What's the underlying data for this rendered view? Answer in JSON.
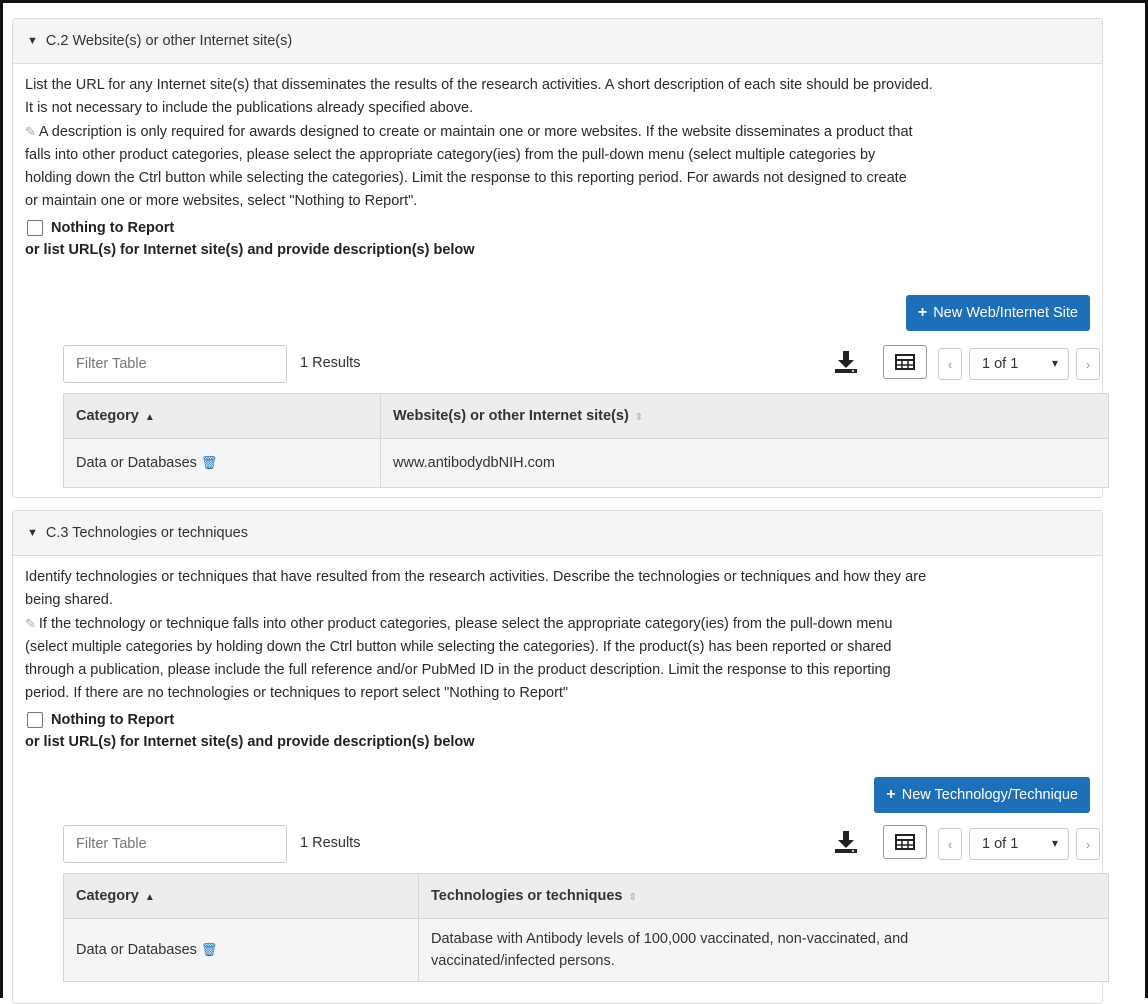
{
  "section_c2": {
    "header": "C.2 Website(s) or other Internet site(s)",
    "intro_line1": "List the URL for any Internet site(s) that disseminates the results of the research activities. A short description of each site should be provided.",
    "intro_line2": "It is not necessary to include the publications already specified above.",
    "note_line1": "A description is only required for awards designed to create or maintain one or more websites. If the website disseminates a product that",
    "note_line2": "falls into other product categories, please select the appropriate category(ies) from the pull-down menu (select multiple categories by",
    "note_line3": "holding down the Ctrl button while selecting the categories). Limit the response to this reporting period. For awards not designed to create",
    "note_line4": "or maintain one or more websites, select \"Nothing to Report\".",
    "nothing_label": "Nothing to Report",
    "or_list": "or list URL(s) for Internet site(s) and provide description(s) below",
    "new_button": "New Web/Internet Site",
    "filter_placeholder": "Filter Table",
    "results": "1 Results",
    "page_label": "1 of 1",
    "columns": [
      "Category",
      "Website(s) or other Internet site(s)"
    ],
    "rows": [
      {
        "category": "Data or Databases",
        "value": "www.antibodydbNIH.com"
      }
    ]
  },
  "section_c3": {
    "header": "C.3 Technologies or techniques",
    "intro_line1": "Identify technologies or techniques that have resulted from the research activities. Describe the technologies or techniques and how they are",
    "intro_line2": "being shared.",
    "note_line1": "If the technology or technique falls into other product categories, please select the appropriate category(ies) from the pull-down menu",
    "note_line2": "(select multiple categories by holding down the Ctrl button while selecting the categories). If the product(s) has been reported or shared",
    "note_line3": "through a publication, please include the full reference and/or PubMed ID in the product description. Limit the response to this reporting",
    "note_line4": "period. If there are no technologies or techniques to report select \"Nothing to Report\"",
    "nothing_label": "Nothing to Report",
    "or_list": "or list URL(s) for Internet site(s) and provide description(s) below",
    "new_button": "New Technology/Technique",
    "filter_placeholder": "Filter Table",
    "results": "1 Results",
    "page_label": "1 of 1",
    "columns": [
      "Category",
      "Technologies or techniques"
    ],
    "rows": [
      {
        "category": "Data or Databases",
        "value_line1": "Database with Antibody levels of 100,000 vaccinated, non-vaccinated, and",
        "value_line2": "vaccinated/infected persons."
      }
    ]
  },
  "colors": {
    "primary": "#1d6fb8",
    "header_bg": "#f5f5f5",
    "table_header_bg": "#ededed"
  },
  "icons": {
    "caret": "caret-down-icon",
    "note": "pencil-note-icon",
    "download": "download-icon",
    "grid": "table-grid-icon",
    "trash": "trash-icon"
  }
}
